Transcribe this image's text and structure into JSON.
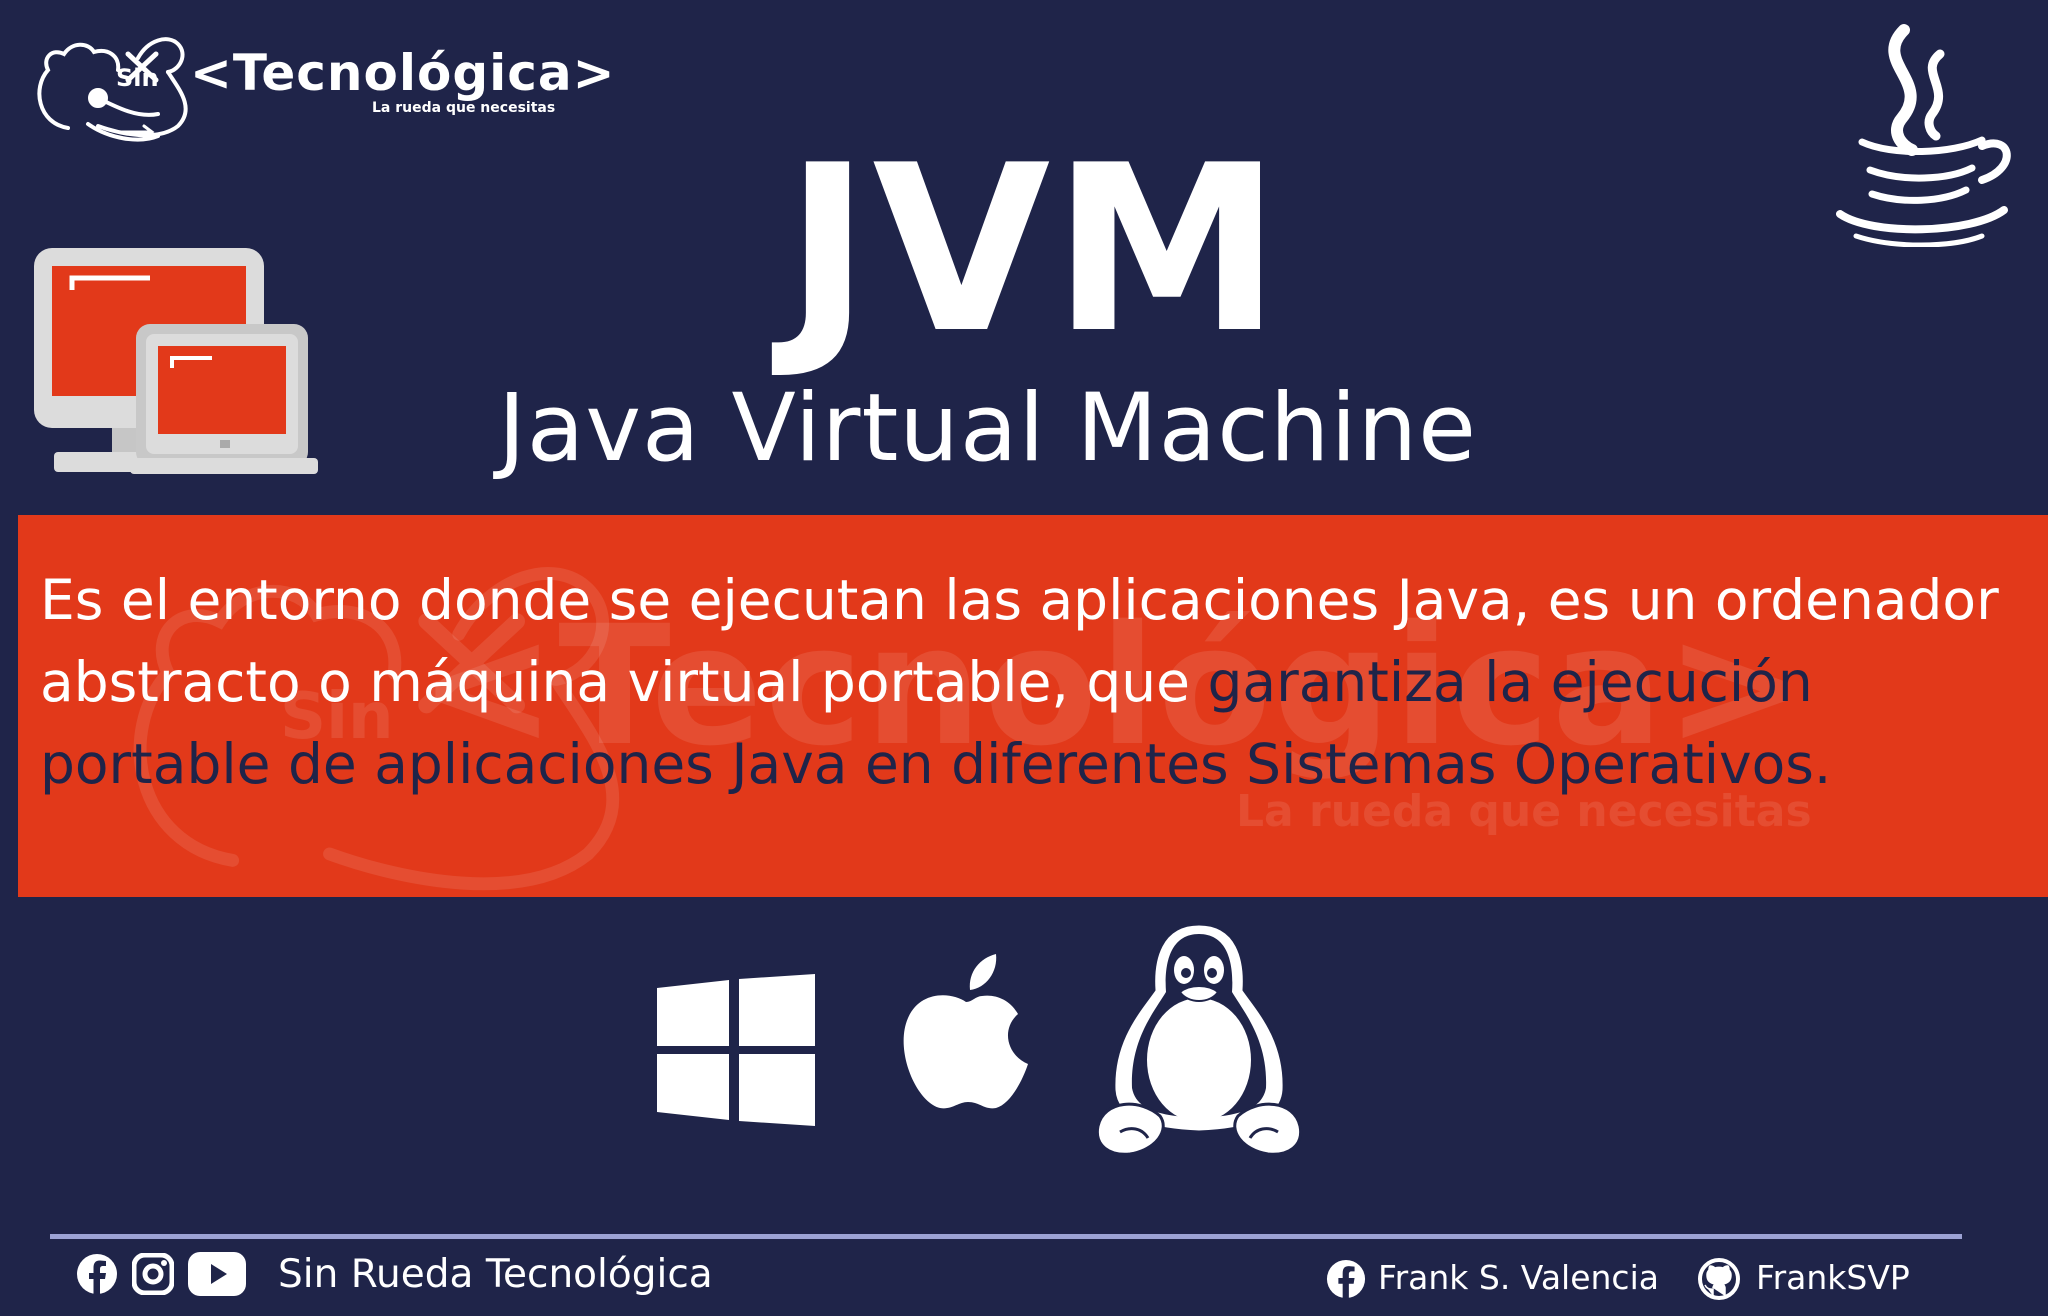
{
  "brand": {
    "prefix": "Sin",
    "name": "<Tecnológica>",
    "tagline": "La rueda que necesitas"
  },
  "title": "JVM",
  "subtitle": "Java Virtual Machine",
  "description": {
    "part1": "Es el entorno donde se ejecutan las aplicaciones Java, es un ordenador abstracto o máquina virtual portable, que",
    "part2": "garantiza la ejecución portable de aplicaciones Java en diferentes Sistemas Operativos."
  },
  "icons": {
    "top_left": "sin-tecnologica-logo",
    "top_right": "java-icon",
    "devices": "monitor-laptop-icon",
    "os": [
      "windows-icon",
      "apple-icon",
      "linux-icon"
    ],
    "social": [
      "facebook-icon",
      "instagram-icon",
      "youtube-icon",
      "github-icon"
    ]
  },
  "footer": {
    "brand_name": "Sin Rueda Tecnológica",
    "author": "Frank S. Valencia",
    "github_user": "FrankSVP"
  },
  "colors": {
    "background": "#1f2449",
    "accent_red": "#e2391a",
    "text": "#ffffff",
    "divider": "#9ca2d4",
    "device_grey": "#dcdcdc"
  }
}
